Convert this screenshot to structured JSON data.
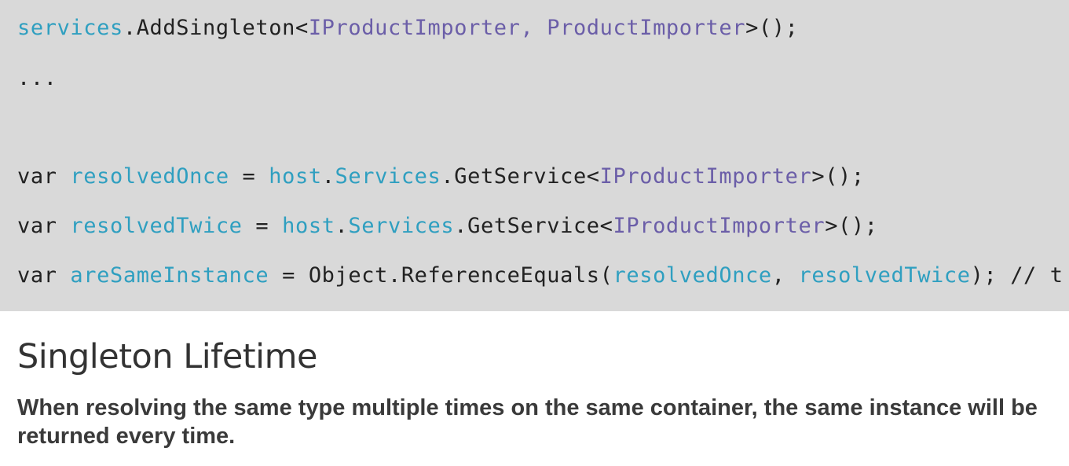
{
  "code": {
    "line1": {
      "var": "services",
      "method": ".AddSingleton<",
      "type1": "IProductImporter,",
      "space": " ",
      "type2": "ProductImporter",
      "end": ">();"
    },
    "line2": "...",
    "line3": {
      "kw": "var ",
      "var": "resolvedOnce",
      "eq": " = ",
      "host": "host",
      "dot": ".",
      "services": "Services",
      "method": ".GetService<",
      "type": "IProductImporter",
      "end": ">();"
    },
    "line4": {
      "kw": "var ",
      "var": "resolvedTwice",
      "eq": " = ",
      "host": "host",
      "dot": ".",
      "services": "Services",
      "method": ".GetService<",
      "type": "IProductImporter",
      "end": ">();"
    },
    "line5": {
      "kw": "var ",
      "var": "areSameInstance",
      "eq": " = Object.ReferenceEquals(",
      "arg1": "resolvedOnce",
      "comma": ", ",
      "arg2": "resolvedTwice",
      "end": "); // t"
    }
  },
  "slide": {
    "title": "Singleton Lifetime",
    "body": "When resolving the same type multiple times on the same container, the same instance will be returned every time."
  },
  "colors": {
    "code_background": "#d9d9d9",
    "identifier": "#2f9fc0",
    "type": "#6b5ea8",
    "plain": "#222222"
  }
}
